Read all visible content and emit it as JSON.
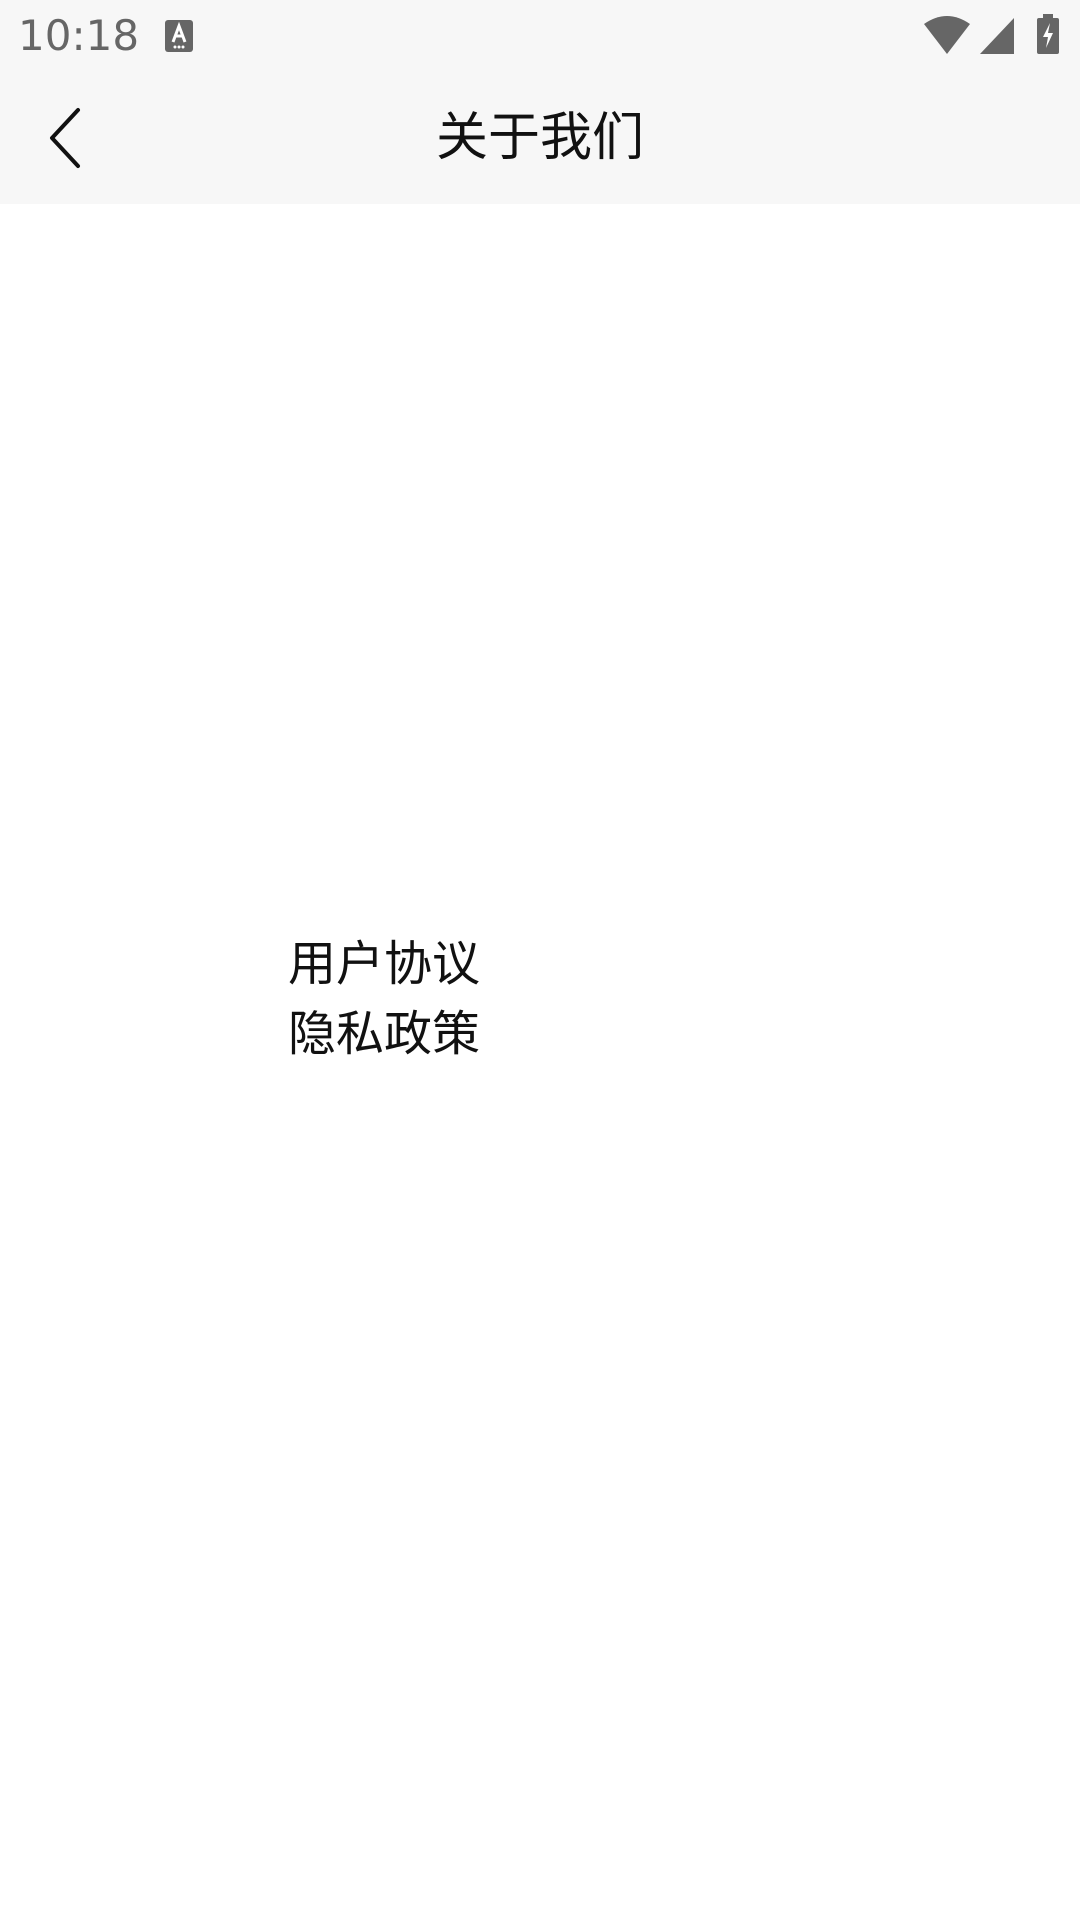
{
  "status_bar": {
    "time": "10:18",
    "icons": [
      "accessibility-a-icon",
      "wifi-icon",
      "cellular-signal-icon",
      "battery-charging-icon"
    ],
    "icon_color": "#666666"
  },
  "app_bar": {
    "title": "关于我们",
    "back_icon": "chevron-left-icon",
    "background": "#f7f7f7"
  },
  "links": {
    "user_agreement": "用户协议",
    "privacy_policy": "隐私政策"
  }
}
